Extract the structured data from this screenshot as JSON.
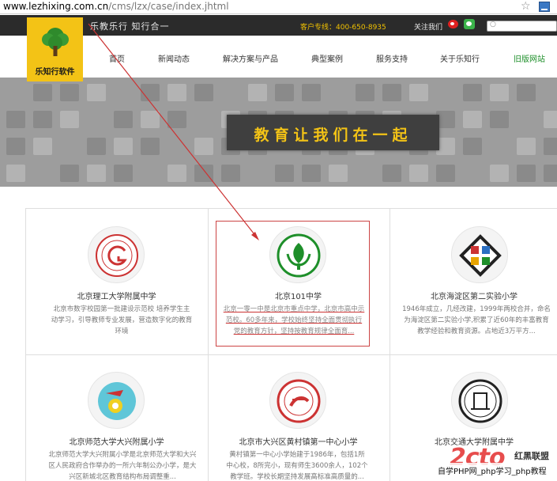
{
  "browser": {
    "url_host": "www.lezhixing.com.cn",
    "url_path": "/cms/lzx/case/index.jhtml"
  },
  "topbar": {
    "slogan": "乐教乐行   知行合一",
    "hotline": "客户专线：400-650-8935",
    "follow": "关注我们"
  },
  "logo": {
    "text": "乐知行软件"
  },
  "nav": {
    "items": [
      "首页",
      "新闻动态",
      "解决方案与产品",
      "典型案例",
      "服务支持",
      "关于乐知行",
      "旧版网站"
    ]
  },
  "banner": {
    "text": "教育让我们在一起"
  },
  "cases": [
    {
      "title": "北京理工大学附属中学",
      "desc": "北京市数字校园第一批建设示范校 培养学生主动学习，引导教师专业发展，营造数字化的教育环境"
    },
    {
      "title": "北京101中学",
      "desc": "北京一零一中是北京市重点中学，北京市高中示范校。60多年来，学校始终坚持全面贯彻执行党的教育方针，坚持按教育规律全面育..."
    },
    {
      "title": "北京海淀区第二实验小学",
      "desc": "1946年成立，几经改建，1999年两校合并，命名为海淀区第二实验小学,积累了近60年的丰富教育教学经验和教育资源。占地近3万平方..."
    },
    {
      "title": "北京师范大学大兴附属小学",
      "desc": "北京师范大学大兴附属小学是北京师范大学和大兴区人民政府合作举办的一所六年制公办小学，是大兴区新城北区教育结构布局调整重..."
    },
    {
      "title": "北京市大兴区黄村镇第一中心小学",
      "desc": "黄村镇第一中心小学始建于1986年，包括1所中心校，8所完小，现有师生3600余人，102个教学班。学校长期坚持发展高标准高质量的..."
    },
    {
      "title": "北京交通大学附属中学",
      "desc": ""
    }
  ],
  "watermark": {
    "big": "2cto",
    "small": "红黑联盟",
    "bar": "自学PHP网_php学习_php教程"
  },
  "colors": {
    "brand_yellow": "#f3c316",
    "topbar_bg": "#2b2b2b",
    "annotation_red": "#cc3333"
  }
}
